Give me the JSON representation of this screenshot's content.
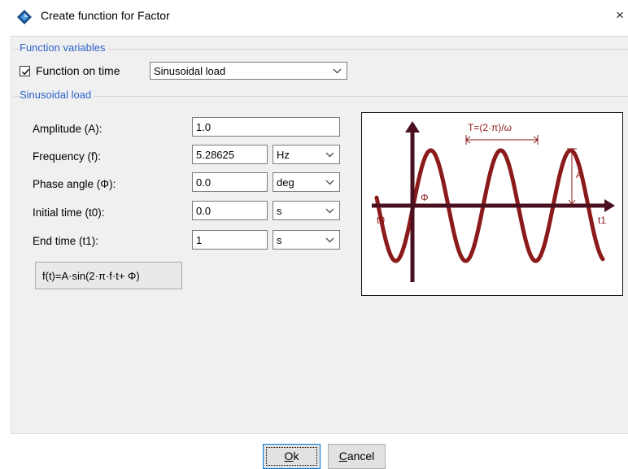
{
  "window": {
    "title": "Create function for Factor",
    "close_glyph": "×",
    "app_icon": "diamond-app-icon"
  },
  "function_variables": {
    "group_title": "Function variables",
    "checkbox_label": "Function on time",
    "checked": true,
    "function_type": "Sinusoidal load"
  },
  "sinusoidal_load": {
    "group_title": "Sinusoidal load",
    "fields": {
      "amplitude": {
        "label": "Amplitude (A):",
        "value": "1.0"
      },
      "frequency": {
        "label": "Frequency (f):",
        "value": "5.28625",
        "unit": "Hz"
      },
      "phase": {
        "label": "Phase angle (Φ):",
        "value": "0.0",
        "unit": "deg"
      },
      "initial_time": {
        "label": "Initial time (t0):",
        "value": "0.0",
        "unit": "s"
      },
      "end_time": {
        "label": "End time (t1):",
        "value": "1",
        "unit": "s"
      }
    },
    "formula": "f(t)=A·sin(2·π·f·t+ Φ)"
  },
  "diagram": {
    "period_label": "T=(2·π)/ω",
    "amplitude_label": "A",
    "phase_label": "Φ",
    "t0_label": "t0",
    "t1_label": "t1",
    "wave_color": "#8b1a1a",
    "axis_color": "#4a1020"
  },
  "buttons": {
    "ok": {
      "mnemonic": "O",
      "rest": "k"
    },
    "cancel": {
      "mnemonic": "C",
      "rest": "ancel"
    }
  }
}
